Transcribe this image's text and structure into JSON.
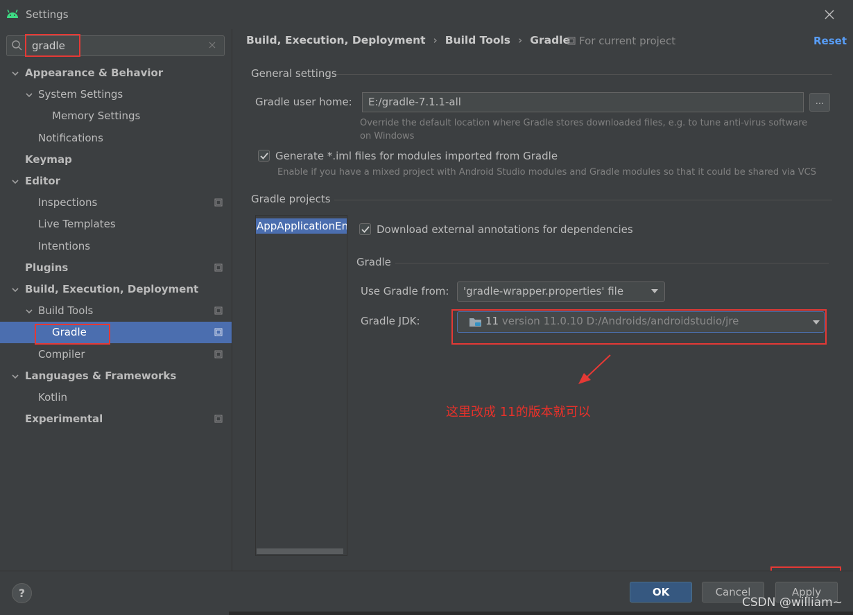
{
  "window": {
    "title": "Settings"
  },
  "search": {
    "value": "gradle"
  },
  "tree": [
    {
      "label": "Appearance & Behavior",
      "bold": true,
      "level": 0,
      "expanded": true,
      "project_icon": false
    },
    {
      "label": "System Settings",
      "bold": false,
      "level": 1,
      "expanded": true,
      "project_icon": false
    },
    {
      "label": "Memory Settings",
      "bold": false,
      "level": 2,
      "project_icon": false
    },
    {
      "label": "Notifications",
      "bold": false,
      "level": 1,
      "project_icon": false
    },
    {
      "label": "Keymap",
      "bold": true,
      "level": 0,
      "project_icon": false
    },
    {
      "label": "Editor",
      "bold": true,
      "level": 0,
      "expanded": true,
      "project_icon": false
    },
    {
      "label": "Inspections",
      "bold": false,
      "level": 1,
      "project_icon": true
    },
    {
      "label": "Live Templates",
      "bold": false,
      "level": 1,
      "project_icon": false
    },
    {
      "label": "Intentions",
      "bold": false,
      "level": 1,
      "project_icon": false
    },
    {
      "label": "Plugins",
      "bold": true,
      "level": 0,
      "project_icon": true
    },
    {
      "label": "Build, Execution, Deployment",
      "bold": true,
      "level": 0,
      "expanded": true,
      "project_icon": false
    },
    {
      "label": "Build Tools",
      "bold": false,
      "level": 1,
      "expanded": true,
      "project_icon": true
    },
    {
      "label": "Gradle",
      "bold": false,
      "level": 2,
      "selected": true,
      "project_icon": true
    },
    {
      "label": "Compiler",
      "bold": false,
      "level": 1,
      "project_icon": true
    },
    {
      "label": "Languages & Frameworks",
      "bold": true,
      "level": 0,
      "expanded": true,
      "project_icon": false
    },
    {
      "label": "Kotlin",
      "bold": false,
      "level": 1,
      "project_icon": false
    },
    {
      "label": "Experimental",
      "bold": true,
      "level": 0,
      "project_icon": true
    }
  ],
  "breadcrumb": [
    "Build, Execution, Deployment",
    "Build Tools",
    "Gradle"
  ],
  "for_current_project": "For current project",
  "reset_label": "Reset",
  "general": {
    "title": "General settings",
    "user_home_label": "Gradle user home:",
    "user_home_value": "E:/gradle-7.1.1-all",
    "browse_label": "...",
    "user_home_hint": "Override the default location where Gradle stores downloaded files, e.g. to tune anti-virus software on Windows",
    "iml_label": "Generate *.iml files for modules imported from Gradle",
    "iml_checked": true,
    "iml_hint": "Enable if you have a mixed project with Android Studio modules and Gradle modules so that it could be shared via VCS"
  },
  "projects": {
    "title": "Gradle projects",
    "items": [
      "AppApplicationEn"
    ],
    "download_annotations_label": "Download external annotations for dependencies",
    "download_annotations_checked": true,
    "gradle_title": "Gradle",
    "use_gradle_from_label": "Use Gradle from:",
    "use_gradle_from_value": "'gradle-wrapper.properties' file",
    "jdk_label": "Gradle JDK:",
    "jdk_version": "11",
    "jdk_detail": "version 11.0.10 D:/Androids/androidstudio/jre"
  },
  "annotation_text": "这里改成 11的版本就可以",
  "footer": {
    "help_label": "?",
    "ok_label": "OK",
    "cancel_label": "Cancel",
    "apply_label": "Apply"
  },
  "watermark": "CSDN @william~",
  "colors": {
    "selection": "#4b6eaf",
    "accent_link": "#589df6",
    "highlight_box": "#e53935",
    "annotation": "#e8312a"
  }
}
